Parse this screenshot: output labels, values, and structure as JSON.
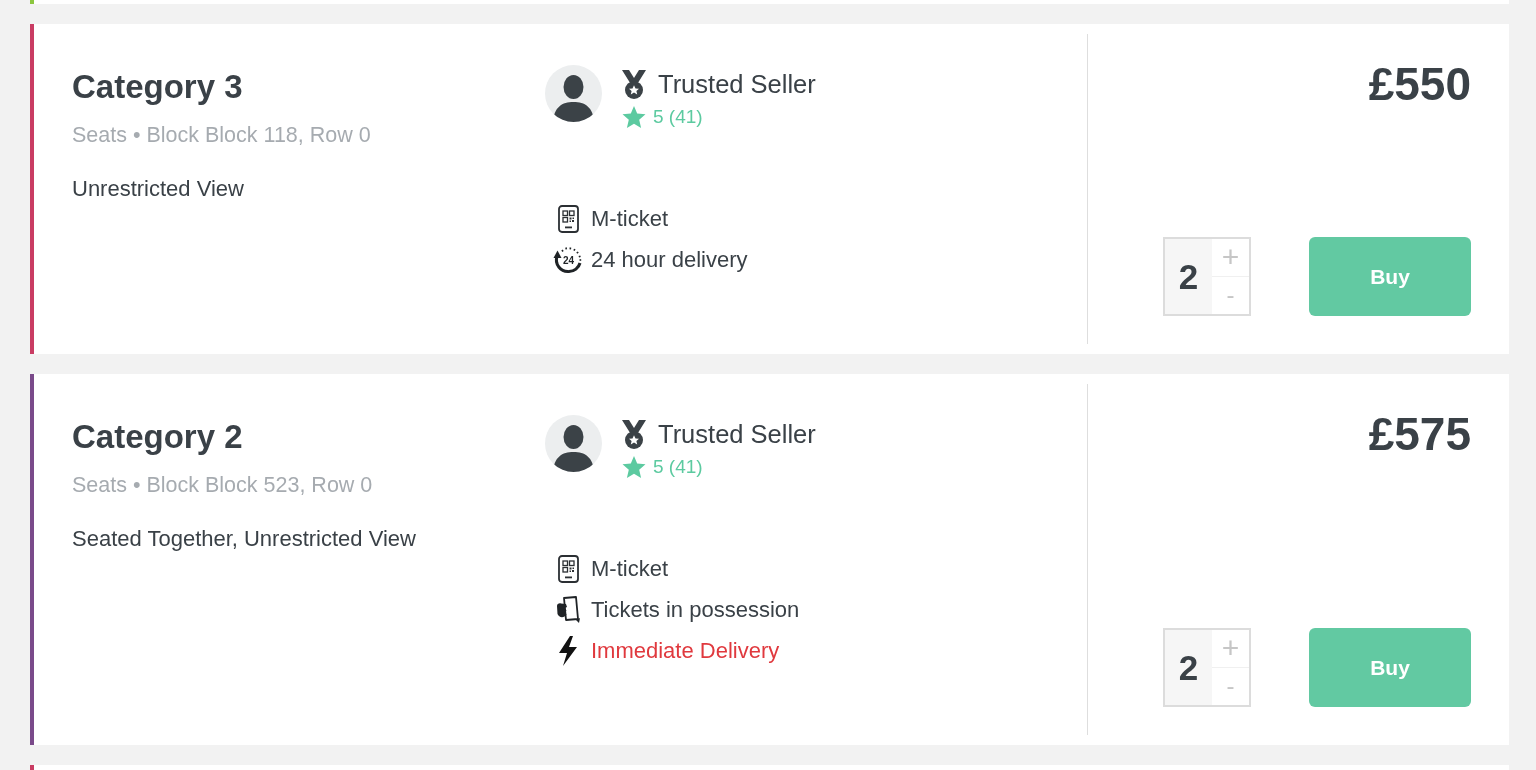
{
  "listings": [
    {
      "kind": "cut",
      "color": "#8cc63f"
    },
    {
      "kind": "full",
      "color": "#c93c63",
      "title": "Category 3",
      "location": "Seats • Block Block 118, Row 0",
      "features": [
        "Unrestricted View"
      ],
      "seller": {
        "badge": "Trusted Seller",
        "rating": "5 (41)"
      },
      "delivery": [
        {
          "kind": "mticket",
          "label": "M-ticket",
          "highlighted": false
        },
        {
          "kind": "timer",
          "icon_label": "24",
          "label": "24 hour delivery",
          "highlighted": false
        }
      ],
      "price": "£550",
      "quantity": {
        "value": "2",
        "increase": "+",
        "decrease": "-"
      },
      "buy": "Buy"
    },
    {
      "kind": "full",
      "color": "#7a4a8a",
      "title": "Category 2",
      "location": "Seats • Block Block 523, Row 0",
      "features": [
        "Seated Together,",
        "Unrestricted View"
      ],
      "seller": {
        "badge": "Trusted Seller",
        "rating": "5 (41)"
      },
      "delivery": [
        {
          "kind": "mticket",
          "label": "M-ticket",
          "highlighted": false
        },
        {
          "kind": "possession",
          "label": "Tickets in possession",
          "highlighted": false
        },
        {
          "kind": "instant",
          "label": "Immediate Delivery",
          "highlighted": true
        }
      ],
      "price": "£575",
      "quantity": {
        "value": "2",
        "increase": "+",
        "decrease": "-"
      },
      "buy": "Buy"
    },
    {
      "kind": "cut",
      "color": "#c93c63"
    }
  ]
}
